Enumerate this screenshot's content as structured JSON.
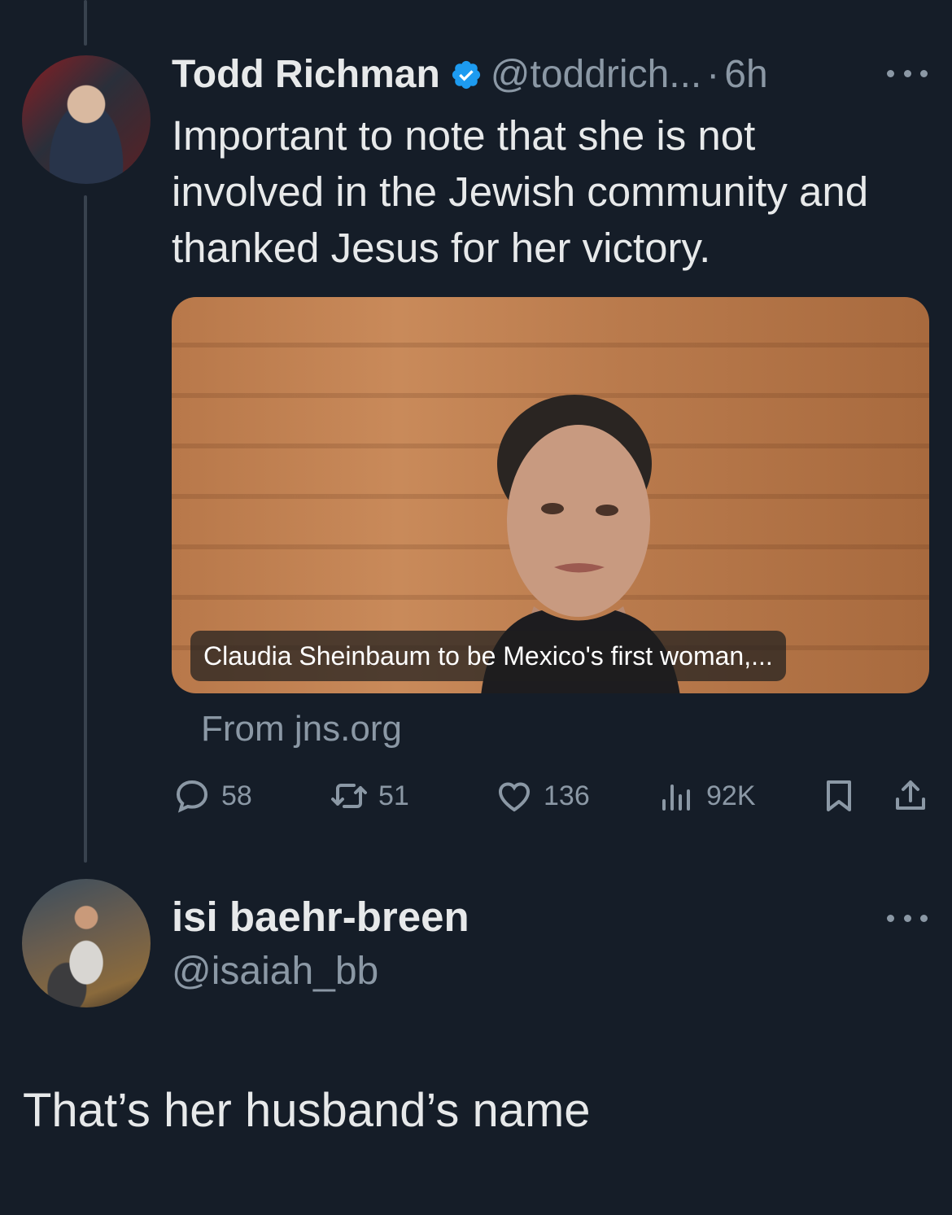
{
  "tweet": {
    "author": {
      "display_name": "Todd Richman",
      "handle": "@toddrich...",
      "verified": true
    },
    "separator": "·",
    "time": "6h",
    "text": "Important to note that she is not involved in the Jewish community and thanked Jesus for her victory.",
    "link_card": {
      "caption": "Claudia Sheinbaum to be Mexico's first woman,...",
      "source": "From jns.org"
    },
    "metrics": {
      "replies": "58",
      "retweets": "51",
      "likes": "136",
      "views": "92K"
    },
    "icons": {
      "reply": "speech-bubble-icon",
      "retweet": "retweet-icon",
      "like": "heart-icon",
      "views": "bar-chart-icon",
      "bookmark": "bookmark-icon",
      "share": "share-icon",
      "more": "more-icon",
      "verified": "verified-badge-icon"
    }
  },
  "reply": {
    "author": {
      "display_name": "isi baehr-breen",
      "handle": "@isaiah_bb"
    },
    "text": "That’s her husband’s name"
  },
  "colors": {
    "background": "#151d28",
    "primary_text": "#e7e9ea",
    "secondary_text": "#8b98a5",
    "verified_blue": "#1d9bf0",
    "thread_line": "#38424e"
  }
}
